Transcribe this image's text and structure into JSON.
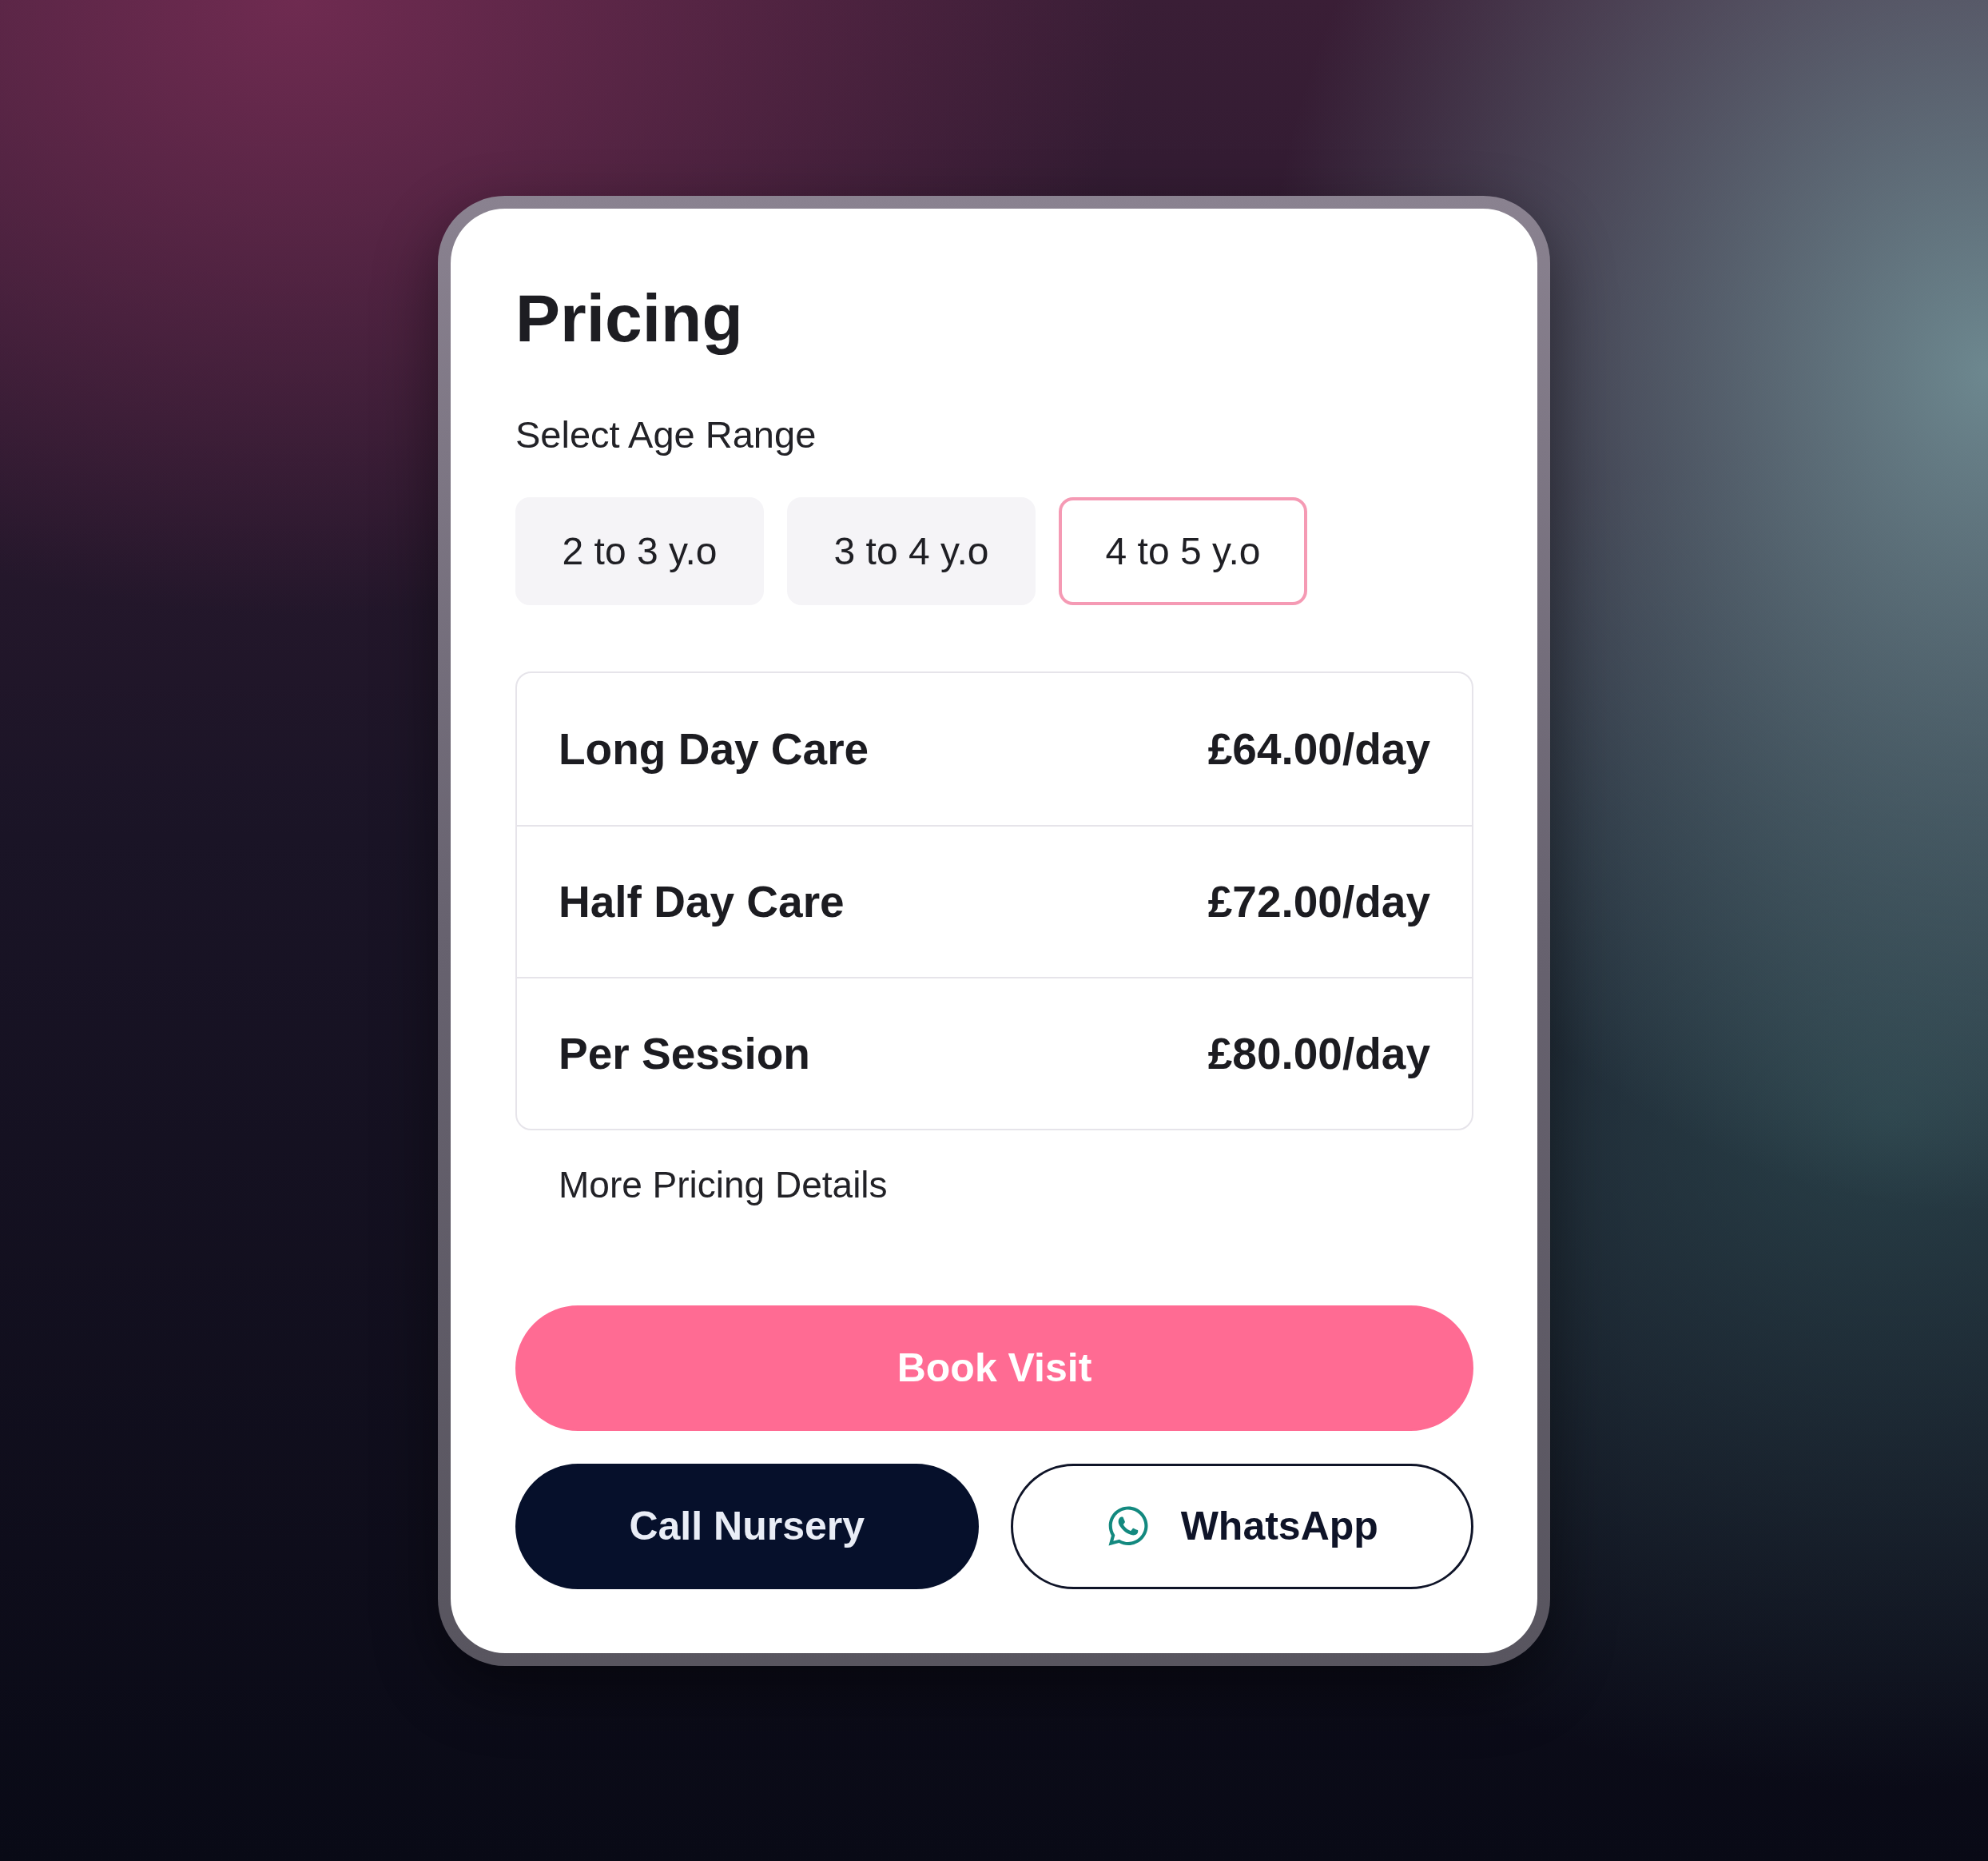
{
  "title": "Pricing",
  "age_range": {
    "label": "Select Age Range",
    "options": [
      {
        "label": "2 to 3 y.o",
        "selected": false
      },
      {
        "label": "3 to 4 y.o",
        "selected": false
      },
      {
        "label": "4 to 5 y.o",
        "selected": true
      }
    ]
  },
  "prices": [
    {
      "name": "Long Day Care",
      "price": "£64.00/day"
    },
    {
      "name": "Half Day Care",
      "price": "£72.00/day"
    },
    {
      "name": "Per Session",
      "price": "£80.00/day"
    }
  ],
  "more_link": "More Pricing Details",
  "buttons": [
    {
      "kind": "primary",
      "label": "Book Visit"
    },
    {
      "kind": "dark",
      "label": "Call Nursery"
    },
    {
      "kind": "whatsapp",
      "label": "WhatsApp"
    }
  ]
}
